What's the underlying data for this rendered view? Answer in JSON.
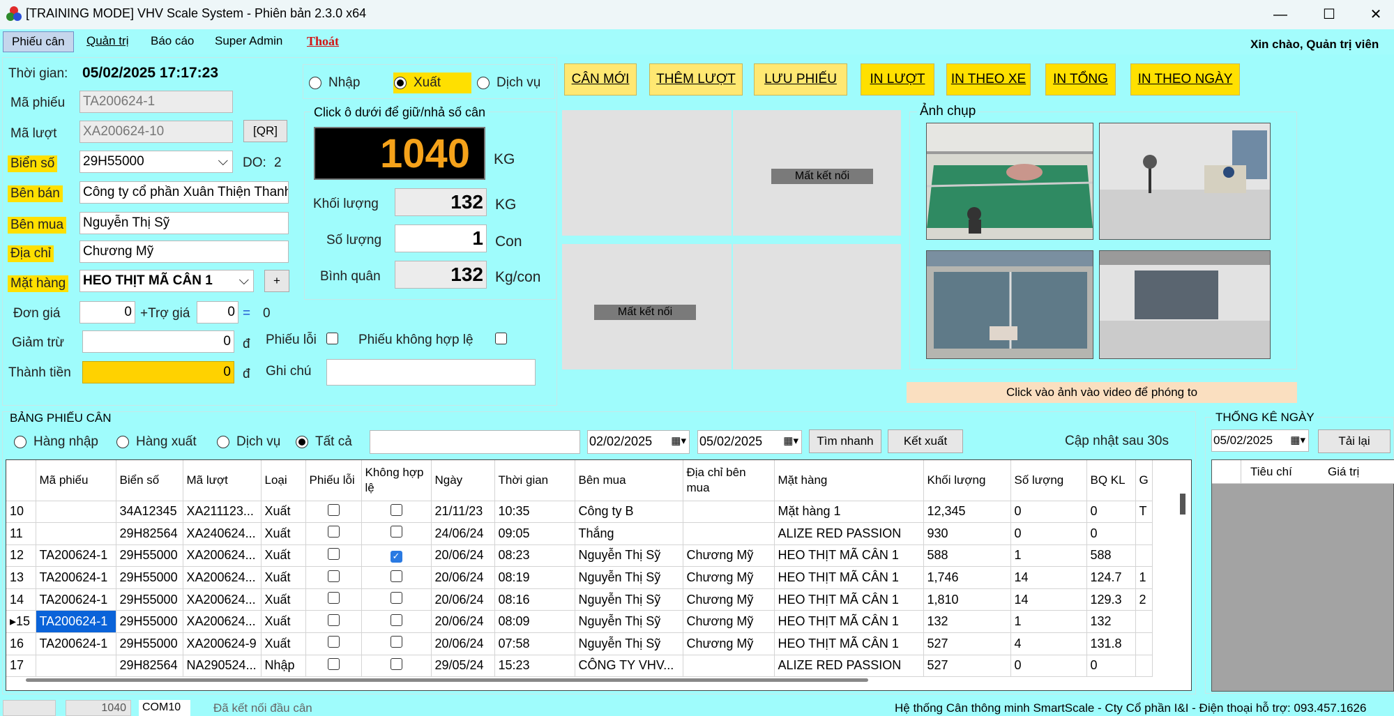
{
  "window": {
    "title": "[TRAINING MODE] VHV Scale System - Phiên bản 2.3.0 x64",
    "minimize": "—",
    "maximize": "☐",
    "close": "✕"
  },
  "menu": {
    "items": [
      "Phiếu cân",
      "Quản trị",
      "Báo cáo",
      "Super Admin"
    ],
    "exit": "Thoát",
    "greeting": "Xin chào, Quản trị viên"
  },
  "form": {
    "time_label": "Thời gian:",
    "time_value": "05/02/2025 17:17:23",
    "ticket_label": "Mã phiếu",
    "ticket_value": "TA200624-1",
    "trip_label": "Mã lượt",
    "trip_value": "XA200624-10",
    "qr_label": "[QR]",
    "plate_label": "Biển số",
    "plate_value": "29H55000",
    "do_label": "DO:",
    "do_value": "2",
    "seller_label": "Bên bán",
    "seller_value": "Công ty cổ phần Xuân Thiện Thanh",
    "buyer_label": "Bên mua",
    "buyer_value": "Nguyễn Thị Sỹ",
    "address_label": "Địa chỉ",
    "address_value": "Chương Mỹ",
    "item_label": "Mặt hàng",
    "item_value": "HEO THỊT MÃ CÂN 1",
    "add_label": "+",
    "price_label": "Đơn giá",
    "price_value": "0",
    "subsidy_label": "+Trợ giá",
    "subsidy_value": "0",
    "equals": "=",
    "price_total": "0",
    "discount_label": "Giảm trừ",
    "discount_value": "0",
    "currency": "đ",
    "error_label": "Phiếu lỗi",
    "invalid_label": "Phiếu không hợp lệ",
    "amount_label": "Thành tiền",
    "amount_value": "0",
    "note_label": "Ghi chú",
    "note_value": ""
  },
  "mode": {
    "options": [
      "Nhập",
      "Xuất",
      "Dịch vụ"
    ],
    "selected": "Xuất"
  },
  "scale": {
    "hint": "Click ô dưới để giữ/nhả số cân",
    "reading": "1040",
    "reading_unit": "KG",
    "weight_label": "Khối lượng",
    "weight_value": "132",
    "weight_unit": "KG",
    "qty_label": "Số lượng",
    "qty_value": "1",
    "qty_unit": "Con",
    "avg_label": "Bình quân",
    "avg_value": "132",
    "avg_unit": "Kg/con"
  },
  "actions": [
    "CÂN MỚI",
    "THÊM LƯỢT",
    "LƯU PHIẾU",
    "IN LƯỢT",
    "IN THEO XE",
    "IN TỔNG",
    "IN THEO NGÀY"
  ],
  "cameras": {
    "disconnected": "Mất kết nối",
    "photos_title": "Ảnh chụp",
    "zoom_hint": "Click vào ảnh vào video để phóng to"
  },
  "table_panel": {
    "title": "BẢNG PHIẾU CÂN",
    "filters": [
      "Hàng nhập",
      "Hàng xuất",
      "Dịch vụ",
      "Tất cả"
    ],
    "filter_selected": "Tất cả",
    "search_value": "",
    "date_from": "02/02/2025",
    "date_to": "05/02/2025",
    "quick_search": "Tìm nhanh",
    "export": "Kết xuất",
    "refresh_note": "Cập nhật sau 30s",
    "columns": [
      "",
      "Mã phiếu",
      "Biển số",
      "Mã lượt",
      "Loại",
      "Phiếu lỗi",
      "Không hợp lệ",
      "Ngày",
      "Thời gian",
      "Bên mua",
      "Địa chỉ bên mua",
      "Mặt hàng",
      "Khối lượng",
      "Số lượng",
      "BQ KL",
      "G"
    ],
    "rows": [
      {
        "no": "10",
        "ticket": "",
        "plate": "34A12345",
        "trip": "XA211123...",
        "type": "Xuất",
        "err": false,
        "inv": false,
        "date": "21/11/23",
        "time": "10:35",
        "buyer": "Công ty B",
        "addr": "",
        "item": "Mặt hàng 1",
        "weight": "12,345",
        "qty": "0",
        "avg": "0",
        "extra": "T"
      },
      {
        "no": "11",
        "ticket": "",
        "plate": "29H82564",
        "trip": "XA240624...",
        "type": "Xuất",
        "err": false,
        "inv": false,
        "date": "24/06/24",
        "time": "09:05",
        "buyer": "Thắng",
        "addr": "",
        "item": "ALIZE RED PASSION",
        "weight": "930",
        "qty": "0",
        "avg": "0",
        "extra": ""
      },
      {
        "no": "12",
        "ticket": "TA200624-1",
        "plate": "29H55000",
        "trip": "XA200624...",
        "type": "Xuất",
        "err": false,
        "inv": true,
        "date": "20/06/24",
        "time": "08:23",
        "buyer": "Nguyễn Thị Sỹ",
        "addr": "Chương Mỹ",
        "item": "HEO THỊT MÃ CÂN 1",
        "weight": "588",
        "qty": "1",
        "avg": "588",
        "extra": ""
      },
      {
        "no": "13",
        "ticket": "TA200624-1",
        "plate": "29H55000",
        "trip": "XA200624...",
        "type": "Xuất",
        "err": false,
        "inv": false,
        "date": "20/06/24",
        "time": "08:19",
        "buyer": "Nguyễn Thị Sỹ",
        "addr": "Chương Mỹ",
        "item": "HEO THỊT MÃ CÂN 1",
        "weight": "1,746",
        "qty": "14",
        "avg": "124.7",
        "extra": "1"
      },
      {
        "no": "14",
        "ticket": "TA200624-1",
        "plate": "29H55000",
        "trip": "XA200624...",
        "type": "Xuất",
        "err": false,
        "inv": false,
        "date": "20/06/24",
        "time": "08:16",
        "buyer": "Nguyễn Thị Sỹ",
        "addr": "Chương Mỹ",
        "item": "HEO THỊT MÃ CÂN 1",
        "weight": "1,810",
        "qty": "14",
        "avg": "129.3",
        "extra": "2"
      },
      {
        "no": "15",
        "ticket": "TA200624-1",
        "plate": "29H55000",
        "trip": "XA200624...",
        "type": "Xuất",
        "err": false,
        "inv": false,
        "date": "20/06/24",
        "time": "08:09",
        "buyer": "Nguyễn Thị Sỹ",
        "addr": "Chương Mỹ",
        "item": "HEO THỊT MÃ CÂN 1",
        "weight": "132",
        "qty": "1",
        "avg": "132",
        "extra": "",
        "selected": true
      },
      {
        "no": "16",
        "ticket": "TA200624-1",
        "plate": "29H55000",
        "trip": "XA200624-9",
        "type": "Xuất",
        "err": false,
        "inv": false,
        "date": "20/06/24",
        "time": "07:58",
        "buyer": "Nguyễn Thị Sỹ",
        "addr": "Chương Mỹ",
        "item": "HEO THỊT MÃ CÂN 1",
        "weight": "527",
        "qty": "4",
        "avg": "131.8",
        "extra": ""
      },
      {
        "no": "17",
        "ticket": "",
        "plate": "29H82564",
        "trip": "NA290524...",
        "type": "Nhập",
        "err": false,
        "inv": false,
        "date": "29/05/24",
        "time": "15:23",
        "buyer": "CÔNG TY VHV...",
        "addr": "",
        "item": "ALIZE RED PASSION",
        "weight": "527",
        "qty": "0",
        "avg": "0",
        "extra": ""
      }
    ]
  },
  "stats": {
    "title": "THỐNG KÊ NGÀY",
    "date": "05/02/2025",
    "reload": "Tải lại",
    "col_criteria": "Tiêu chí",
    "col_value": "Giá trị"
  },
  "status": {
    "reading": "1040",
    "port": "COM10",
    "connection": "Đã kết nối đầu cân",
    "footer": "Hệ thống Cân thông minh SmartScale - Cty Cổ phần I&I - Điện thoại hỗ trợ: 093.457.1626"
  }
}
